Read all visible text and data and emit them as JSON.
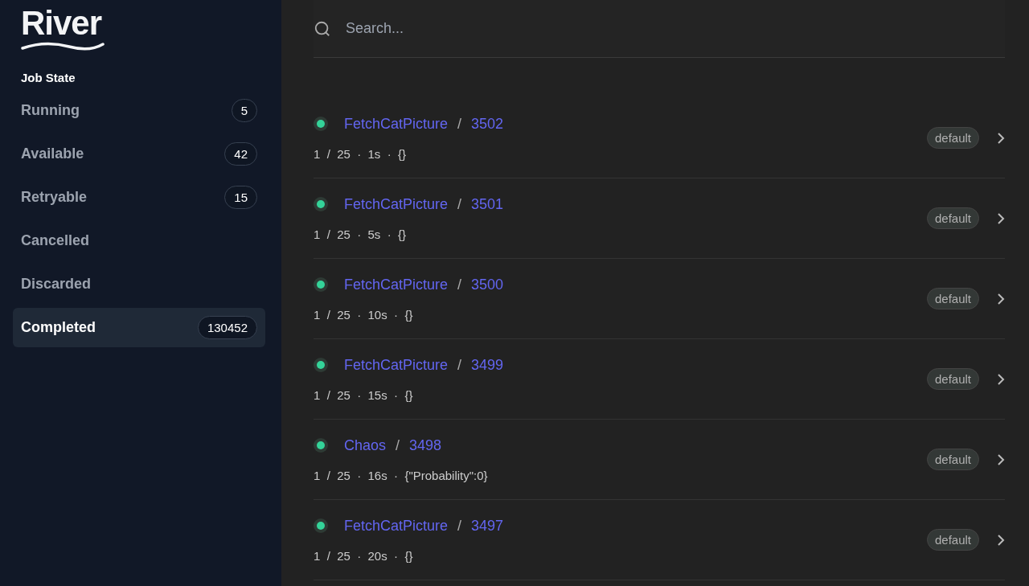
{
  "logo": "River",
  "sidebar": {
    "heading": "Job State",
    "items": [
      {
        "label": "Running",
        "count": "5",
        "selected": false
      },
      {
        "label": "Available",
        "count": "42",
        "selected": false
      },
      {
        "label": "Retryable",
        "count": "15",
        "selected": false
      },
      {
        "label": "Cancelled",
        "selected": false
      },
      {
        "label": "Discarded",
        "selected": false
      },
      {
        "label": "Completed",
        "count": "130452",
        "selected": true
      }
    ]
  },
  "search": {
    "placeholder": "Search..."
  },
  "jobs": [
    {
      "kind": "FetchCatPicture",
      "separator": "/",
      "id": "3502",
      "meta": "1  /  25  ·  1s  ·  {}",
      "queue": "default",
      "color": "#34d399"
    },
    {
      "kind": "FetchCatPicture",
      "separator": "/",
      "id": "3501",
      "meta": "1  /  25  ·  5s  ·  {}",
      "queue": "default",
      "color": "#34d399"
    },
    {
      "kind": "FetchCatPicture",
      "separator": "/",
      "id": "3500",
      "meta": "1  /  25  ·  10s  ·  {}",
      "queue": "default",
      "color": "#34d399"
    },
    {
      "kind": "FetchCatPicture",
      "separator": "/",
      "id": "3499",
      "meta": "1  /  25  ·  15s  ·  {}",
      "queue": "default",
      "color": "#34d399"
    },
    {
      "kind": "Chaos",
      "separator": "/",
      "id": "3498",
      "meta": "1  /  25  ·  16s  ·  {\"Probability\":0}",
      "queue": "default",
      "color": "#34d399"
    },
    {
      "kind": "FetchCatPicture",
      "separator": "/",
      "id": "3497",
      "meta": "1  /  25  ·  20s  ·  {}",
      "queue": "default",
      "color": "#34d399"
    }
  ]
}
